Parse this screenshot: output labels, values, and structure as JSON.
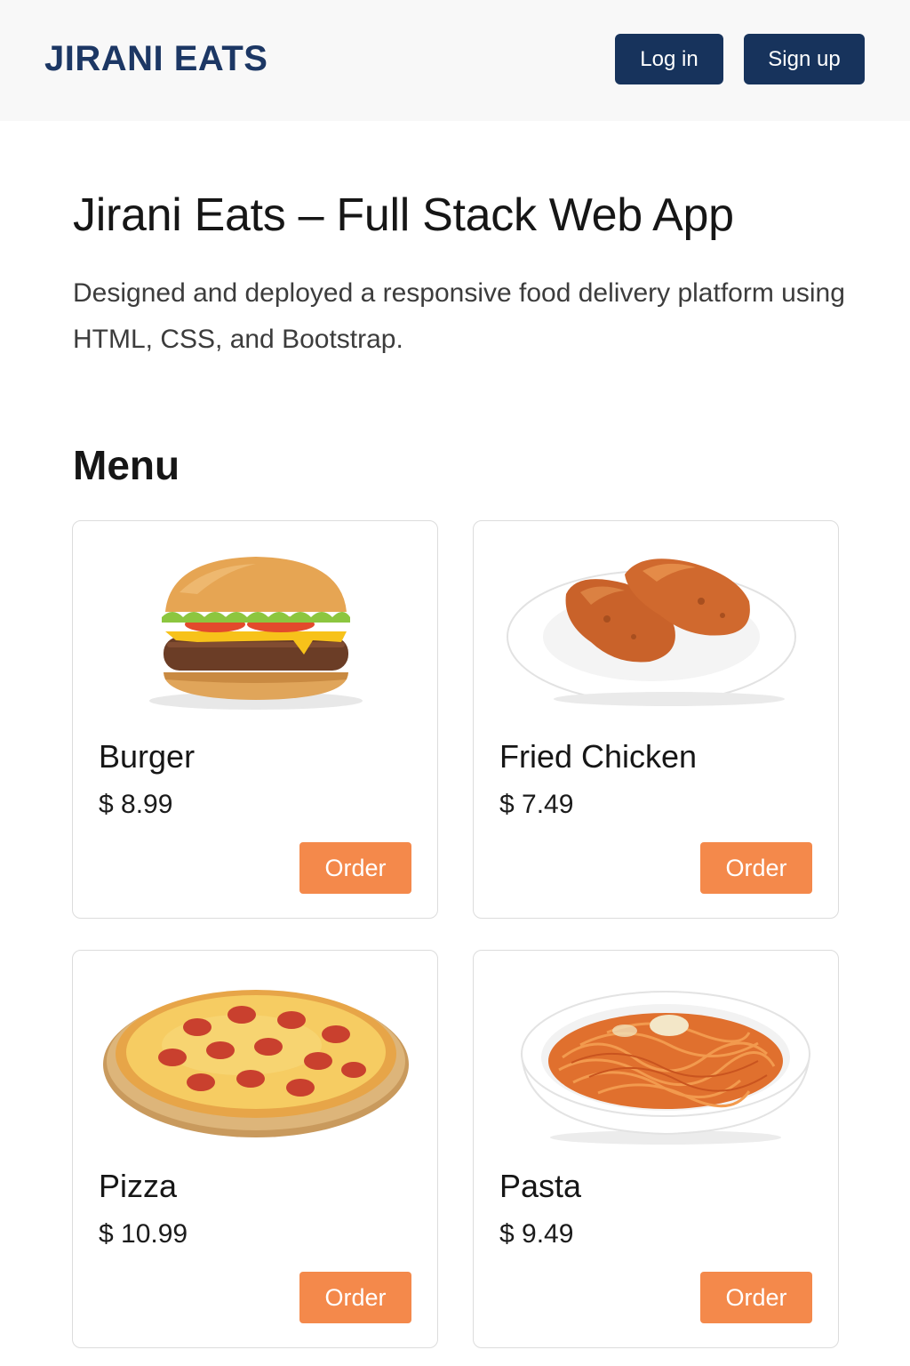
{
  "navbar": {
    "brand": "JIRANI EATS",
    "login_label": "Log in",
    "signup_label": "Sign up"
  },
  "hero": {
    "title": "Jirani Eats – Full Stack Web App",
    "description": "Designed and deployed a responsive food delivery platform using HTML, CSS, and Bootstrap."
  },
  "menu": {
    "title": "Menu",
    "items": [
      {
        "name": "Burger",
        "price": "$ 8.99",
        "order_label": "Order",
        "image": "burger-image"
      },
      {
        "name": "Fried Chicken",
        "price": "$ 7.49",
        "order_label": "Order",
        "image": "fried-chicken-image"
      },
      {
        "name": "Pizza",
        "price": "$ 10.99",
        "order_label": "Order",
        "image": "pizza-image"
      },
      {
        "name": "Pasta",
        "price": "$ 9.49",
        "order_label": "Order",
        "image": "pasta-image"
      }
    ]
  },
  "colors": {
    "brand": "#1c3764",
    "nav_button": "#17335c",
    "order_button": "#f4894b"
  }
}
